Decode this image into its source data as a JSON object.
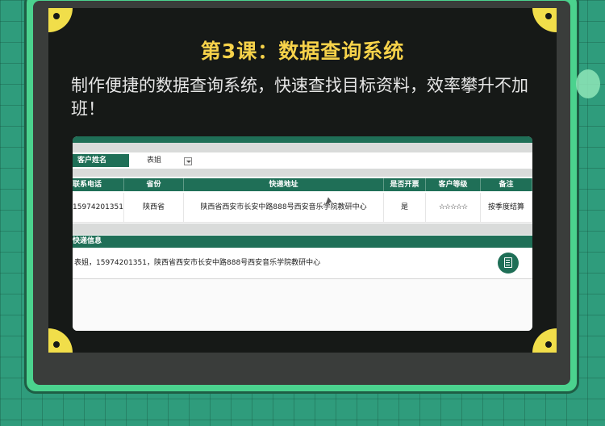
{
  "lesson": {
    "title": "第3课：数据查询系统",
    "description": "制作便捷的数据查询系统，快速查找目标资料，效率攀升不加班！"
  },
  "screenshot": {
    "customer_name_label": "客户姓名",
    "customer_name_value": "表姐",
    "table": {
      "headers": [
        "联系电话",
        "省份",
        "快递地址",
        "是否开票",
        "客户等级",
        "备注"
      ],
      "row": [
        "15974201351",
        "陕西省",
        "陕西省西安市长安中路888号西安音乐学院教研中心",
        "是",
        "☆☆☆☆☆",
        "按季度结算"
      ]
    },
    "express": {
      "header": "快递信息",
      "text": "表姐，15974201351，陕西省西安市长安中路888号西安音乐学院教研中心"
    }
  },
  "icons": [
    "dropdown-arrow-icon",
    "copy-icon",
    "mouse-cursor-icon"
  ],
  "colors": {
    "accent_green": "#1f6f57",
    "title_yellow": "#f6d24a",
    "frame_green": "#4bd28e",
    "corner_yellow": "#f1de4a"
  }
}
